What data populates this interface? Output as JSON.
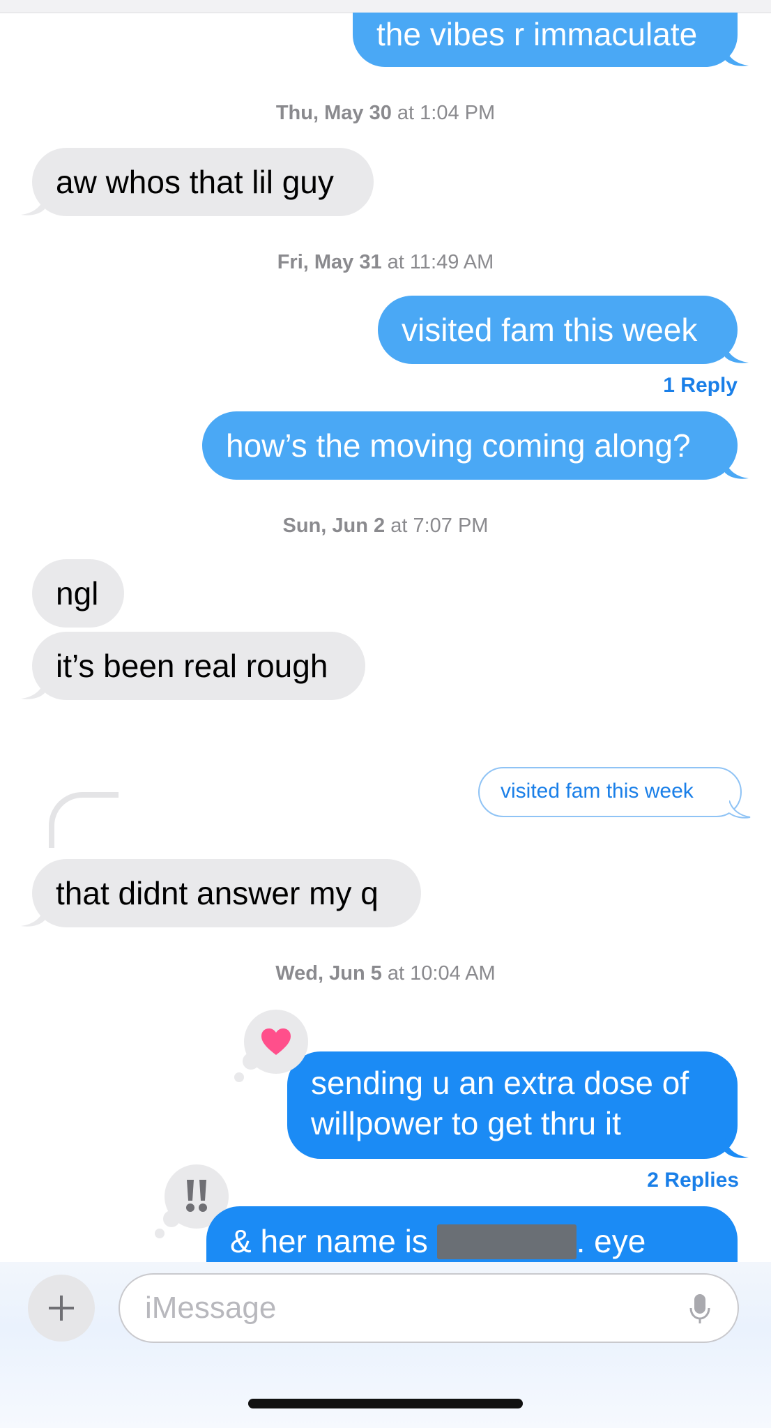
{
  "conversation": {
    "msg_vibes": "the vibes r immaculate",
    "ts1_day": "Thu, May 30",
    "ts1_time": "at 1:04 PM",
    "msg_lil_guy": "aw whos that lil guy",
    "ts2_day": "Fri, May 31",
    "ts2_time": "at 11:49 AM",
    "msg_visited": "visited fam this week",
    "reply_count_1": "1 Reply",
    "msg_moving": "how’s the moving coming along?",
    "ts3_day": "Sun, Jun 2",
    "ts3_time": "at 7:07 PM",
    "msg_ngl": "ngl",
    "msg_rough": "it’s been real rough",
    "quoted_reply": "visited fam this week",
    "msg_didnt_answer": "that didnt answer my q",
    "ts4_day": "Wed, Jun 5",
    "ts4_time": "at 10:04 AM",
    "msg_willpower_line1": "sending u an extra dose of",
    "msg_willpower_line2": "willpower to get thru it",
    "reply_count_2": "2 Replies",
    "msg_name_part1": "& her name is",
    "msg_name_part2": ". eye"
  },
  "tapbacks": {
    "first": "heart-icon",
    "second": "double-exclamation-icon"
  },
  "composer": {
    "placeholder": "iMessage"
  },
  "colors": {
    "outgoing": "#1b8bf5",
    "incoming": "#e9e9eb",
    "link": "#1a7fe8",
    "heart": "#ff4f8b"
  }
}
